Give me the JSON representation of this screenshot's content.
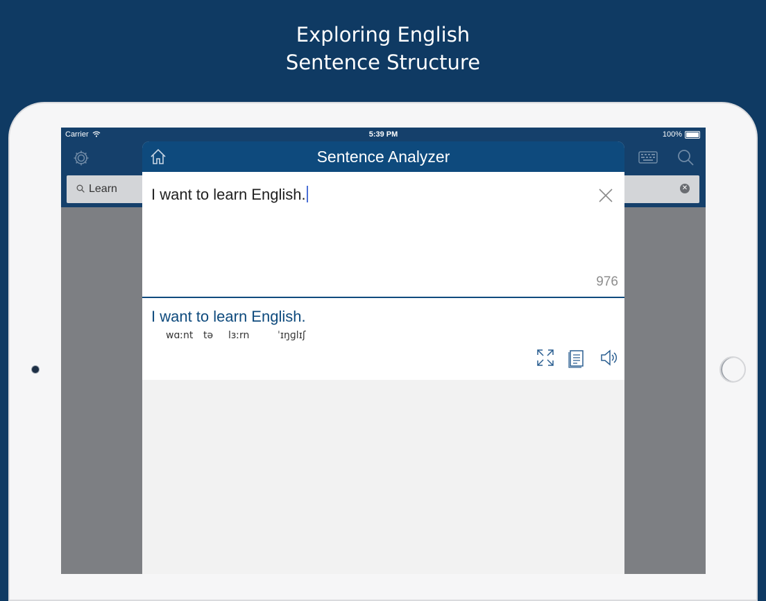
{
  "promo": {
    "line1": "Exploring English",
    "line2": "Sentence Structure"
  },
  "status_bar": {
    "carrier": "Carrier",
    "time": "5:39 PM",
    "battery": "100%"
  },
  "search": {
    "query": "Learn"
  },
  "modal": {
    "title": "Sentence Analyzer",
    "input_text": "I want to learn English.",
    "char_counter": "976",
    "result": {
      "sentence": "I want to learn English.",
      "pronunciations": [
        "wɑːnt",
        "tə",
        "lɜːrn",
        "ˈɪŋɡlɪʃ"
      ]
    }
  },
  "icons": {
    "settings": "gear-icon",
    "keyboard": "keyboard-icon",
    "search": "search-icon",
    "home": "home-icon",
    "clear": "close-icon",
    "expand": "expand-icon",
    "document": "document-icon",
    "speaker": "speaker-icon"
  },
  "colors": {
    "background": "#0f3a63",
    "navbar": "#15406b",
    "modal_header": "#0e4a7d",
    "result_text": "#0e4a7d"
  }
}
